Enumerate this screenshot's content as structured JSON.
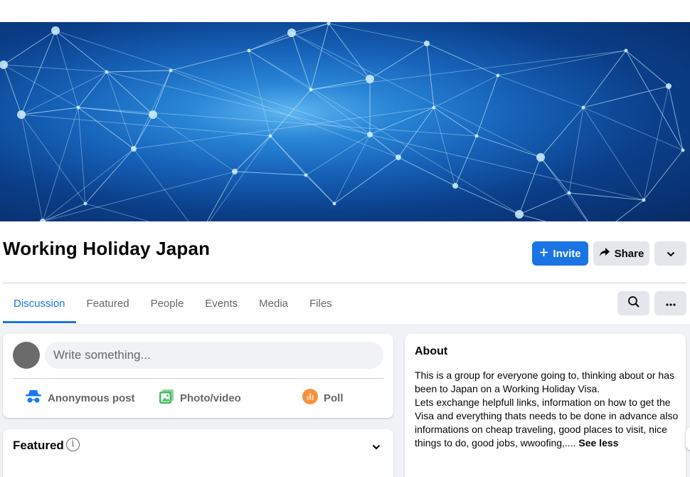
{
  "group": {
    "title": "Working Holiday Japan"
  },
  "actions": {
    "invite_label": "Invite",
    "share_label": "Share"
  },
  "tabs": [
    {
      "label": "Discussion",
      "active": true
    },
    {
      "label": "Featured"
    },
    {
      "label": "People"
    },
    {
      "label": "Events"
    },
    {
      "label": "Media"
    },
    {
      "label": "Files"
    }
  ],
  "composer": {
    "placeholder": "Write something...",
    "anonymous_label": "Anonymous post",
    "photo_label": "Photo/video",
    "poll_label": "Poll"
  },
  "featured": {
    "title": "Featured"
  },
  "about": {
    "title": "About",
    "text": "This is a group for everyone going to, thinking about or has been to Japan on a Working Holiday Visa.\nLets exchange helpfull links, information on how to get the Visa and everything thats needs to be done in advance also informations on cheap traveling, good places to visit, nice things to do, good jobs, wwoofing,.... ",
    "see_less": "See less"
  },
  "colors": {
    "accent": "#1b74e4",
    "button_gray": "#e4e6eb",
    "feed_bg": "#f0f2f5",
    "poll_orange": "#f7923b",
    "photo_green": "#45bd62",
    "anon_blue": "#1877f2"
  },
  "icons": [
    "plus-icon",
    "share-arrow-icon",
    "chevron-down-icon",
    "search-icon",
    "more-icon",
    "incognito-icon",
    "photo-icon",
    "poll-icon",
    "info-icon"
  ]
}
